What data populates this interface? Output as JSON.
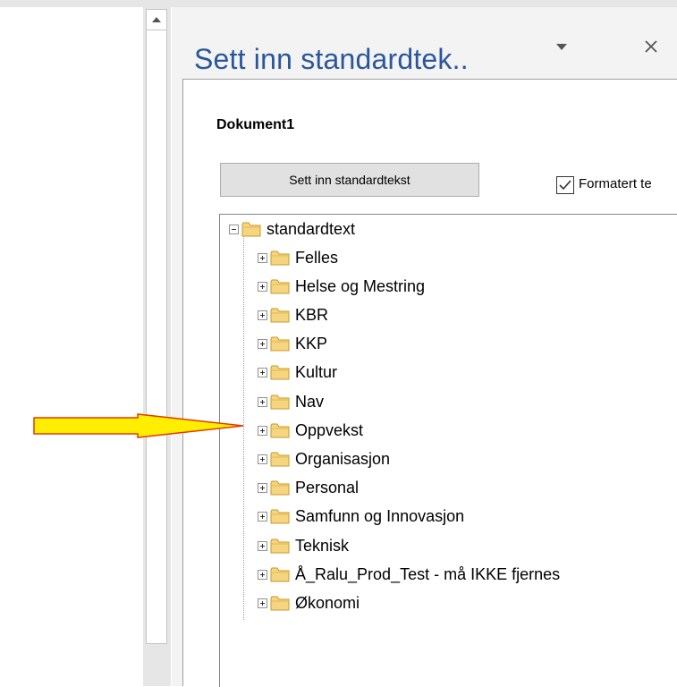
{
  "pane": {
    "title": "Sett inn standardtek..",
    "document_name": "Dokument1",
    "insert_button_label": "Sett inn standardtekst",
    "formatted_checkbox_label": "Formatert te",
    "formatted_checked": true
  },
  "tree": {
    "root_label": "standardtext",
    "children": [
      "Felles",
      "Helse og Mestring",
      "KBR",
      "KKP",
      "Kultur",
      "Nav",
      "Oppvekst",
      "Organisasjon",
      "Personal",
      "Samfunn og Innovasjon",
      "Teknisk",
      "Å_Ralu_Prod_Test - må  IKKE fjernes",
      "Økonomi"
    ]
  },
  "colors": {
    "title": "#2b579a",
    "arrow_fill": "#ffee00",
    "arrow_stroke": "#e23b00",
    "folder_fill": "#f6d580",
    "folder_stroke": "#c49a2c"
  },
  "icons": {
    "menu": "chevron-down-icon",
    "close": "close-icon",
    "folder": "folder-icon",
    "expander": "tree-expander-icon",
    "annotation": "arrow-right-icon"
  }
}
